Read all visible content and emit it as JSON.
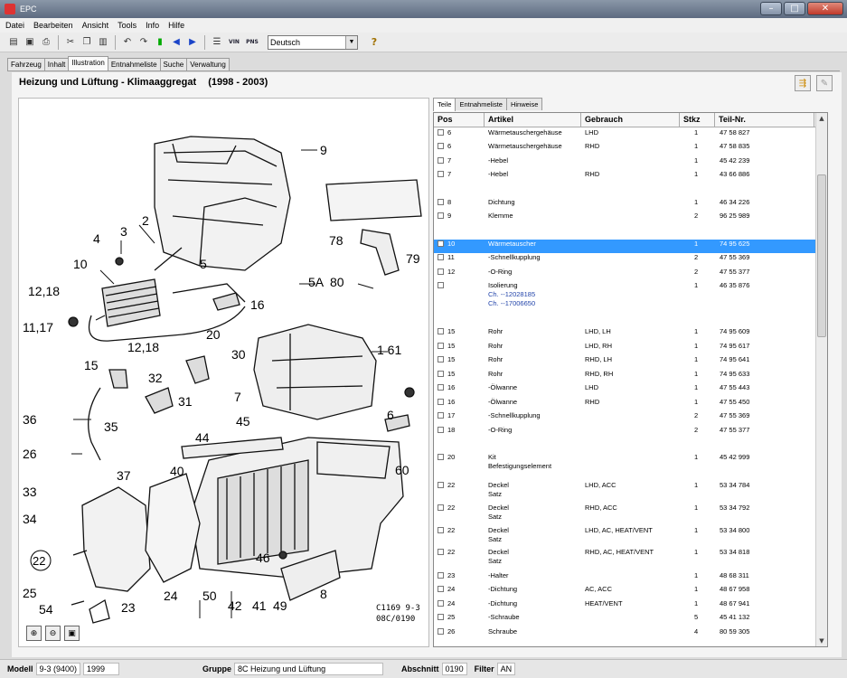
{
  "window": {
    "title": "EPC"
  },
  "menu": [
    "Datei",
    "Bearbeiten",
    "Ansicht",
    "Tools",
    "Info",
    "Hilfe"
  ],
  "toolbar": {
    "language": "Deutsch",
    "vin_label": "VIN",
    "nvs_label": "PNS"
  },
  "main_tabs": [
    "Fahrzeug",
    "Inhalt",
    "Illustration",
    "Entnahmeliste",
    "Suche",
    "Verwaltung"
  ],
  "page": {
    "title": "Heizung und Lüftung - Klimaaggregat",
    "years": "(1998 - 2003)"
  },
  "illustration": {
    "code_line1": "C1169 9-3",
    "code_line2": "08C/0190",
    "labels": [
      "9",
      "2",
      "3",
      "4",
      "5",
      "10",
      "12,18",
      "11,17",
      "12,18",
      "15",
      "16",
      "5A",
      "80",
      "78",
      "79",
      "20",
      "30",
      "1",
      "61",
      "32",
      "31",
      "7",
      "36",
      "35",
      "45",
      "6",
      "26",
      "44",
      "37",
      "40",
      "60",
      "33",
      "34",
      "22",
      "46",
      "25",
      "54",
      "23",
      "24",
      "50",
      "42",
      "41",
      "49",
      "8"
    ]
  },
  "sub_tabs": [
    "Teile",
    "Entnahmeliste",
    "Hinweise"
  ],
  "parts": {
    "headers": {
      "pos": "Pos",
      "artikel": "Artikel",
      "gebrauch": "Gebrauch",
      "stkz": "Stkz",
      "teilnr": "Teil-Nr."
    },
    "rows": [
      {
        "pos": "6",
        "artikel": "Wärmetauschergehäuse",
        "gebrauch": "LHD",
        "stkz": "1",
        "teilnr": "47 58 827"
      },
      {
        "pos": "6",
        "artikel": "Wärmetauschergehäuse",
        "gebrauch": "RHD",
        "stkz": "1",
        "teilnr": "47 58 835"
      },
      {
        "pos": "7",
        "artikel": "-Hebel",
        "gebrauch": "",
        "stkz": "1",
        "teilnr": "45 42 239"
      },
      {
        "pos": "7",
        "artikel": "-Hebel",
        "gebrauch": "RHD",
        "stkz": "1",
        "teilnr": "43 66 886"
      },
      {
        "pos": "8",
        "artikel": "Dichtung",
        "gebrauch": "",
        "stkz": "1",
        "teilnr": "46 34 226"
      },
      {
        "pos": "9",
        "artikel": "Klemme",
        "gebrauch": "",
        "stkz": "2",
        "teilnr": "96 25 989"
      },
      {
        "pos": "10",
        "artikel": "Wärmetauscher",
        "gebrauch": "",
        "stkz": "1",
        "teilnr": "74 95 625"
      },
      {
        "pos": "11",
        "artikel": "-Schnellkupplung",
        "gebrauch": "",
        "stkz": "2",
        "teilnr": "47 55 369"
      },
      {
        "pos": "12",
        "artikel": "-O-Ring",
        "gebrauch": "",
        "stkz": "2",
        "teilnr": "47 55 377"
      },
      {
        "pos": "",
        "artikel": "Isolierung",
        "gebrauch": "",
        "stkz": "1",
        "teilnr": "46 35 876"
      },
      {
        "pos": "15",
        "artikel": "Rohr",
        "gebrauch": "LHD, LH",
        "stkz": "1",
        "teilnr": "74 95 609"
      },
      {
        "pos": "15",
        "artikel": "Rohr",
        "gebrauch": "LHD, RH",
        "stkz": "1",
        "teilnr": "74 95 617"
      },
      {
        "pos": "15",
        "artikel": "Rohr",
        "gebrauch": "RHD, LH",
        "stkz": "1",
        "teilnr": "74 95 641"
      },
      {
        "pos": "15",
        "artikel": "Rohr",
        "gebrauch": "RHD, RH",
        "stkz": "1",
        "teilnr": "74 95 633"
      },
      {
        "pos": "16",
        "artikel": "-Ölwanne",
        "gebrauch": "LHD",
        "stkz": "1",
        "teilnr": "47 55 443"
      },
      {
        "pos": "16",
        "artikel": "-Ölwanne",
        "gebrauch": "RHD",
        "stkz": "1",
        "teilnr": "47 55 450"
      },
      {
        "pos": "17",
        "artikel": "-Schnellkupplung",
        "gebrauch": "",
        "stkz": "2",
        "teilnr": "47 55 369"
      },
      {
        "pos": "18",
        "artikel": "-O-Ring",
        "gebrauch": "",
        "stkz": "2",
        "teilnr": "47 55 377"
      },
      {
        "pos": "20",
        "artikel": "Kit",
        "artikel2": "Befestigungselement",
        "gebrauch": "",
        "stkz": "1",
        "teilnr": "45 42 999"
      },
      {
        "pos": "22",
        "artikel": "Deckel",
        "artikel2": "Satz",
        "gebrauch": "LHD, ACC",
        "stkz": "1",
        "teilnr": "53 34 784"
      },
      {
        "pos": "22",
        "artikel": "Deckel",
        "artikel2": "Satz",
        "gebrauch": "RHD, ACC",
        "stkz": "1",
        "teilnr": "53 34 792"
      },
      {
        "pos": "22",
        "artikel": "Deckel",
        "artikel2": "Satz",
        "gebrauch": "LHD, AC, HEAT/VENT",
        "stkz": "1",
        "teilnr": "53 34 800"
      },
      {
        "pos": "22",
        "artikel": "Deckel",
        "artikel2": "Satz",
        "gebrauch": "RHD, AC, HEAT/VENT",
        "stkz": "1",
        "teilnr": "53 34 818"
      },
      {
        "pos": "23",
        "artikel": "-Halter",
        "gebrauch": "",
        "stkz": "1",
        "teilnr": "48 68 311"
      },
      {
        "pos": "24",
        "artikel": "-Dichtung",
        "gebrauch": "AC, ACC",
        "stkz": "1",
        "teilnr": "48 67 958"
      },
      {
        "pos": "24",
        "artikel": "-Dichtung",
        "gebrauch": "HEAT/VENT",
        "stkz": "1",
        "teilnr": "48 67 941"
      },
      {
        "pos": "25",
        "artikel": "-Schraube",
        "gebrauch": "",
        "stkz": "5",
        "teilnr": "45 41 132"
      },
      {
        "pos": "26",
        "artikel": "Schraube",
        "gebrauch": "",
        "stkz": "4",
        "teilnr": "80 59 305"
      }
    ],
    "isolierung_notes": [
      "Ch. --12028185",
      "Ch. --17006650"
    ]
  },
  "status": {
    "modell_label": "Modell",
    "modell": "9-3 (9400)",
    "year": "1999",
    "gruppe_label": "Gruppe",
    "gruppe": "8C Heizung und Lüftung",
    "abschnitt_label": "Abschnitt",
    "abschnitt": "0190",
    "filter_label": "Filter",
    "filter": "AN"
  }
}
